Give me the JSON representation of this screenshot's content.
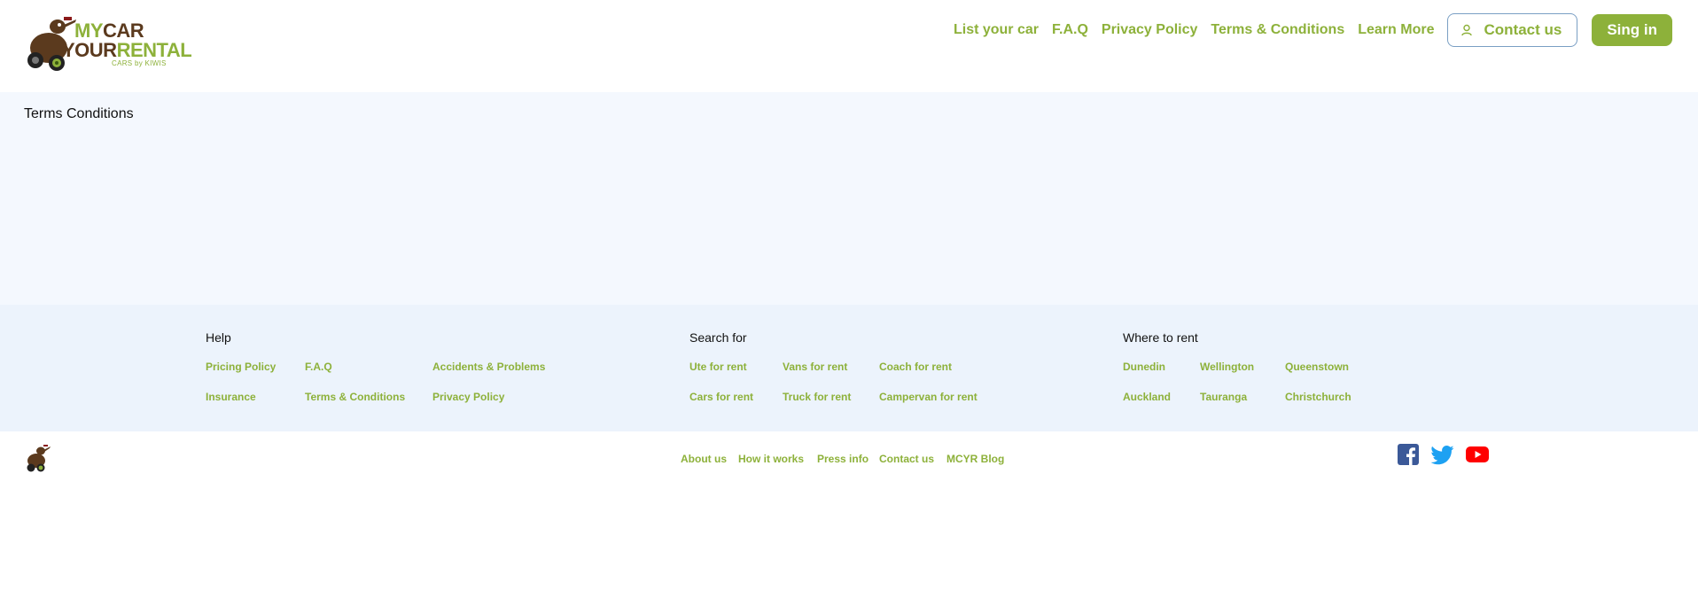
{
  "brand": {
    "line1_a": "MY",
    "line1_b": "CAR",
    "line2_a": "YOUR",
    "line2_b": "RENTAL",
    "tagline": "CARS by KIWIS",
    "colors": {
      "green": "#8db13a",
      "brown": "#5b3a1e"
    }
  },
  "nav": {
    "links": [
      "List your car",
      "F.A.Q",
      "Privacy Policy",
      "Terms & Conditions",
      "Learn More"
    ],
    "contact_label": "Contact us",
    "signin_label": "Sing in"
  },
  "main": {
    "title": "Terms Conditions"
  },
  "footer": {
    "help": {
      "title": "Help",
      "links": [
        "Pricing Policy",
        "F.A.Q",
        "Accidents & Problems",
        "Insurance",
        "Terms & Conditions",
        "Privacy Policy"
      ]
    },
    "search": {
      "title": "Search for",
      "links": [
        "Ute for rent",
        "Vans for rent",
        "Coach for rent",
        "Cars for rent",
        "Truck for rent",
        "Campervan for rent"
      ]
    },
    "where": {
      "title": "Where to rent",
      "links": [
        "Dunedin",
        "Wellington",
        "Queenstown",
        "Auckland",
        "Tauranga",
        "Christchurch"
      ]
    },
    "bottom_links": [
      "About us",
      "How it works",
      "Press info",
      "Contact us",
      "MCYR Blog"
    ],
    "social_icons": [
      "facebook-icon",
      "twitter-icon",
      "youtube-icon"
    ]
  }
}
